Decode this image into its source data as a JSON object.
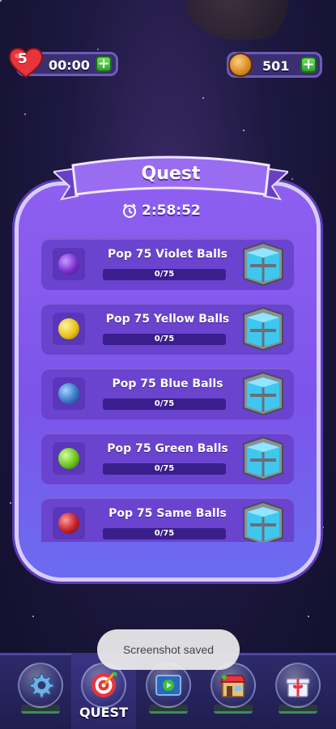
{
  "hud": {
    "lives": "5",
    "lives_timer": "00:00",
    "coins": "501",
    "plus_label": "+",
    "heart_color": "#e8343c",
    "coin_color": "#e08a22",
    "plus_color": "#3cc13a"
  },
  "quest": {
    "title": "Quest",
    "countdown": "2:58:52",
    "items": [
      {
        "title": "Pop 75 Violet Balls",
        "progress_text": "0/75",
        "progress": 0,
        "ball_color": "#7a2fd1",
        "reward_icon": "chest-icon"
      },
      {
        "title": "Pop 75 Yellow Balls",
        "progress_text": "0/75",
        "progress": 0,
        "ball_color": "#e8c21a",
        "reward_icon": "chest-icon"
      },
      {
        "title": "Pop 75 Blue Balls",
        "progress_text": "0/75",
        "progress": 0,
        "ball_color": "#3a78c8",
        "reward_icon": "chest-icon"
      },
      {
        "title": "Pop 75 Green Balls",
        "progress_text": "0/75",
        "progress": 0,
        "ball_color": "#6cc21e",
        "reward_icon": "chest-icon"
      },
      {
        "title": "Pop 75 Same Balls",
        "progress_text": "0/75",
        "progress": 0,
        "ball_color": "#c2202a",
        "reward_icon": "chest-icon"
      }
    ]
  },
  "toast": {
    "text": "Screenshot saved"
  },
  "nav": {
    "items": [
      {
        "icon": "gear-icon",
        "label": ""
      },
      {
        "icon": "target-icon",
        "label": "QUEST",
        "active": true
      },
      {
        "icon": "video-icon",
        "label": ""
      },
      {
        "icon": "shop-icon",
        "label": ""
      },
      {
        "icon": "gift-icon",
        "label": ""
      }
    ]
  }
}
